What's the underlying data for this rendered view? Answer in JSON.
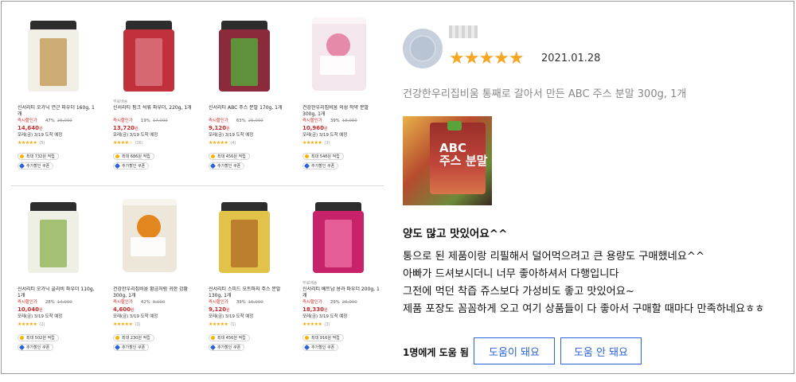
{
  "products": [
    {
      "tag": "",
      "name": "신서리티 오가닉 연근 파우더 160g, 1개",
      "discount_label": "즉시할인가",
      "discount_rate": "47%",
      "original_price": "26,000",
      "sale_price": "14,640",
      "currency": "원",
      "delivery": "모레(금) 3/19 도착 예정",
      "stars": "★★★★★",
      "rating": 4.5,
      "review_count": "(5)",
      "points": "최대 732원 적립",
      "coupon": "추가할인 쿠폰",
      "package": "jar",
      "color": "#f1efe6",
      "accent": "#c9a56a"
    },
    {
      "tag": "무료배송",
      "name": "신서리티 핑크 석류 파우더, 220g, 1개",
      "discount_label": "즉시할인가",
      "discount_rate": "19%",
      "original_price": "17,000",
      "sale_price": "13,720",
      "currency": "원",
      "delivery": "모레(금) 3/19 도착 예정",
      "stars": "★★★★☆",
      "rating": 4,
      "review_count": "(26)",
      "points": "최대 686원 적립",
      "coupon": "추가할인 쿠폰",
      "package": "jar",
      "color": "#c0313d",
      "accent": "#d76c74"
    },
    {
      "tag": "",
      "name": "신서리티 ABC 주스 분말 170g, 1개",
      "discount_label": "즉시할인가",
      "discount_rate": "63%",
      "original_price": "25,000",
      "sale_price": "9,120",
      "currency": "원",
      "delivery": "모레(금) 3/19 도착 예정",
      "stars": "★★★★★",
      "rating": 5,
      "review_count": "(4)",
      "points": "최대 456원 적립",
      "coupon": "추가할인 쿠폰",
      "package": "jar",
      "color": "#8a2a3a",
      "accent": "#5a9a3a"
    },
    {
      "tag": "",
      "name": "건강한우리집비움 의성 작약 분말 300g, 1개",
      "discount_label": "즉시할인가",
      "discount_rate": "39%",
      "original_price": "18,000",
      "sale_price": "10,960",
      "currency": "원",
      "delivery": "모레(금) 3/19 도착 예정",
      "stars": "★★★★★",
      "rating": 5,
      "review_count": "(3)",
      "points": "최대 548원 적립",
      "coupon": "추가할인 쿠폰",
      "package": "pouch",
      "color": "#f3e6ec",
      "accent": "#e58aa8"
    },
    {
      "tag": "",
      "name": "신서리티 오가닉 콜리비 파우더 110g, 1개",
      "discount_label": "즉시할인가",
      "discount_rate": "28%",
      "original_price": "14,000",
      "sale_price": "10,040",
      "currency": "원",
      "delivery": "모레(금) 3/19 도착 예정",
      "stars": "★★★★★",
      "rating": 5,
      "review_count": "(2)",
      "points": "최대 502원 적립",
      "coupon": "추가할인 쿠폰",
      "package": "jar",
      "color": "#eef0e6",
      "accent": "#9cbc6a"
    },
    {
      "tag": "",
      "name": "건강한우리집비움 황금처럼 귀한 강황 300g, 1개",
      "discount_label": "즉시할인가",
      "discount_rate": "42%",
      "original_price": "8,000",
      "sale_price": "4,600",
      "currency": "원",
      "delivery": "모레(금) 3/19 도착 예정",
      "stars": "★★★★★",
      "rating": 5,
      "review_count": "(3)",
      "points": "최대 230원 적립",
      "coupon": "추가할인 쿠폰",
      "package": "pouch",
      "color": "#ede7d9",
      "accent": "#e2861e"
    },
    {
      "tag": "",
      "name": "신서리티 스피드 오트파지 주스 분말 130g, 1개",
      "discount_label": "즉시할인가",
      "discount_rate": "39%",
      "original_price": "15,000",
      "sale_price": "9,120",
      "currency": "원",
      "delivery": "모레(금) 3/19 도착 예정",
      "stars": "★★★★★",
      "rating": 5,
      "review_count": "(1)",
      "points": "최대 456원 적립",
      "coupon": "추가할인 쿠폰",
      "package": "jar",
      "color": "#e3c24a",
      "accent": "#b8792a"
    },
    {
      "tag": "무료배송",
      "name": "신서리티 베트남 용과 파우더 200g, 1개",
      "discount_label": "즉시할인가",
      "discount_rate": "29%",
      "original_price": "26,000",
      "sale_price": "18,330",
      "currency": "원",
      "delivery": "모레(금) 3/19 도착 예정",
      "stars": "★★★★★",
      "rating": 5,
      "review_count": "(3)",
      "points": "최대 916원 적립",
      "coupon": "추가할인 쿠폰",
      "package": "jar",
      "color": "#c7226a",
      "accent": "#e6639b"
    }
  ],
  "review": {
    "date": "2021.01.28",
    "rating": 5,
    "stars": "★★★★★",
    "product_name": "건강한우리집비움 통째로 갈아서 만든 ABC 주스 분말 300g, 1개",
    "photo_text": "ABC\n주스 분말",
    "headline": "양도 많고 맛있어요^^",
    "body": [
      "통으로 된 제품이랑 리필해서 덜어먹으려고 큰 용량도 구매했네요^^",
      "아빠가 드셔보시더니 너무 좋아하셔서 다행입니다",
      "그전에 먹던 착즙 쥬스보다 가성비도 좋고 맛있어요~",
      "제품 포장도 꼼꼼하게 오고 여기 상품들이 다 좋아서 구매할 때마다 만족하네요ㅎㅎ"
    ],
    "helpful_count": "1명에게 도움 됨",
    "helpful_yes": "도움이 돼요",
    "helpful_no": "도움 안 돼요"
  }
}
